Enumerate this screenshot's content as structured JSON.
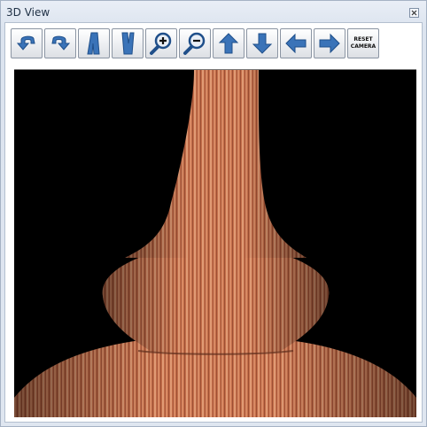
{
  "window": {
    "title": "3D View",
    "close_icon": "close-x-icon"
  },
  "toolbar": {
    "buttons": [
      {
        "name": "rotate-left-icon"
      },
      {
        "name": "rotate-right-icon"
      },
      {
        "name": "tilt-left-icon"
      },
      {
        "name": "tilt-right-icon"
      },
      {
        "name": "zoom-in-icon"
      },
      {
        "name": "zoom-out-icon"
      },
      {
        "name": "arrow-up-icon"
      },
      {
        "name": "arrow-down-icon"
      },
      {
        "name": "arrow-left-icon"
      },
      {
        "name": "arrow-right-icon"
      }
    ],
    "reset_label_line1": "RESET",
    "reset_label_line2": "CAMERA"
  },
  "viewport": {
    "background": "#000000",
    "object_color": "#c8704a",
    "object": "wooden vase model (3D render)"
  },
  "colors": {
    "icon_blue": "#3a73b8",
    "icon_dark": "#1f4f8a",
    "frame": "#dce4ef"
  }
}
